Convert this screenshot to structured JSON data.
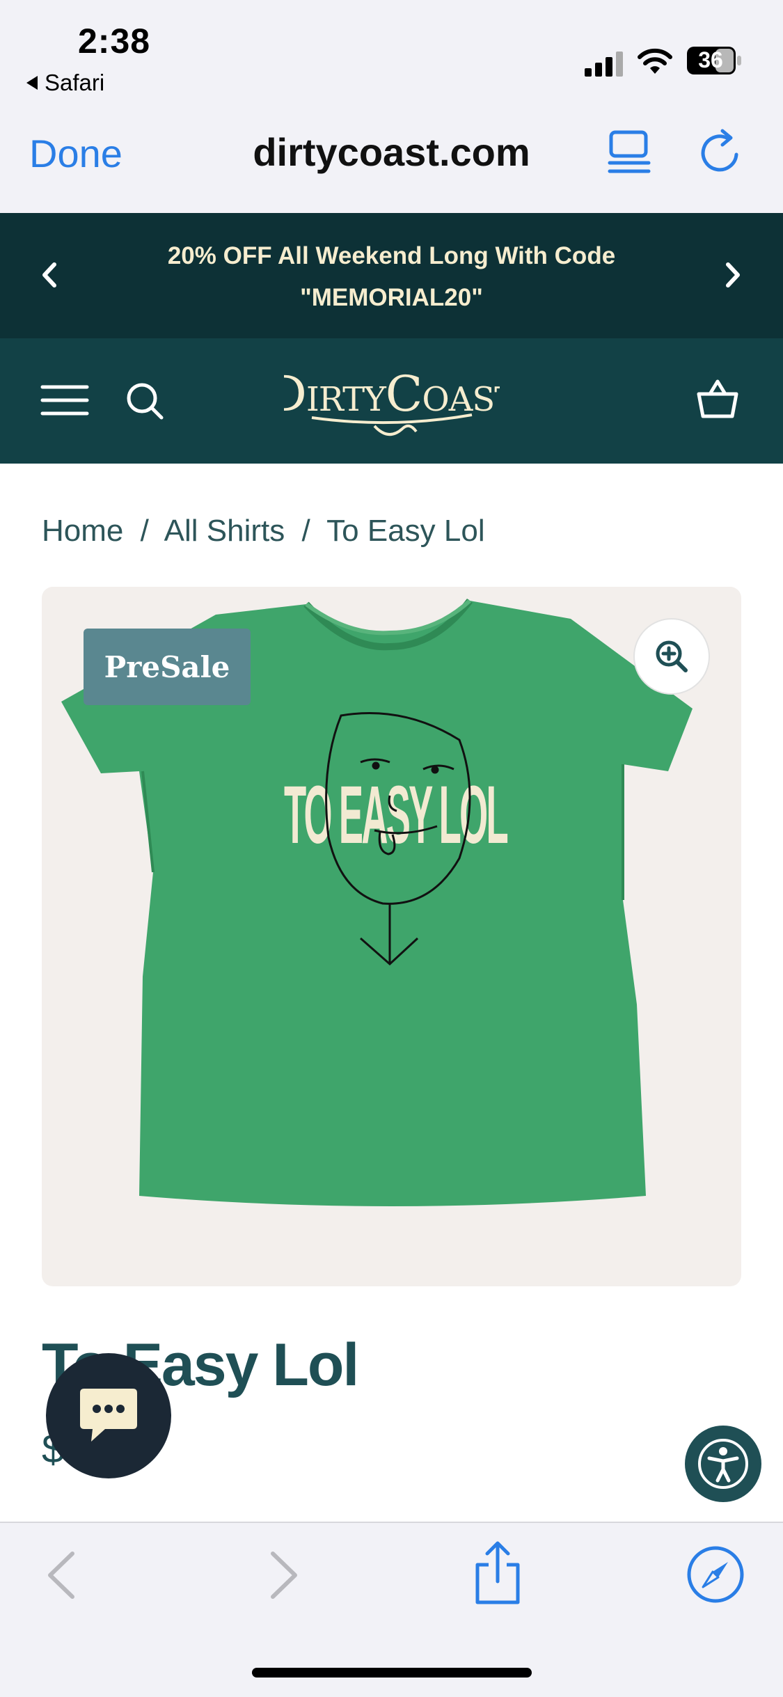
{
  "status_bar": {
    "time": "2:38",
    "back_app": "Safari",
    "battery": "36"
  },
  "browser": {
    "done_label": "Done",
    "url": "dirtycoast.com",
    "accent_color": "#2a7ee6"
  },
  "promo": {
    "line1": "20% OFF All Weekend Long With Code",
    "line2": "\"MEMORIAL20\""
  },
  "header": {
    "logo_text": "DIRTY COAST"
  },
  "breadcrumb": {
    "items": [
      "Home",
      "All Shirts",
      "To Easy Lol"
    ],
    "separator": "/"
  },
  "product": {
    "badge": "PreSale",
    "shirt_print": "TO EASY LOL",
    "title": "To Easy Lol",
    "price": "$"
  },
  "colors": {
    "promo_bg": "#0d3136",
    "nav_bg": "#124146",
    "brand_text": "#1f4f55",
    "shirt_green": "#3fa56b"
  }
}
